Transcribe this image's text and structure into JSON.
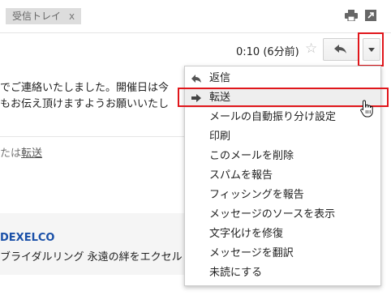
{
  "top_bar": {
    "label_chip": "受信トレイ",
    "label_chip_close": "x"
  },
  "header": {
    "time": "0:10 (6分前)"
  },
  "body": {
    "line1": "でご連絡いたしました。開催日は今",
    "line2": "もお伝え頂けますようお願いいたし",
    "reply_hint_prefix": "たは",
    "reply_hint_link": "転送"
  },
  "promo": {
    "brand": "DEXELCO",
    "text": "ブライダルリング 永遠の絆をエクセル"
  },
  "menu": {
    "items": [
      {
        "label": "返信",
        "icon": "reply-arrow-icon"
      },
      {
        "label": "転送",
        "icon": "forward-arrow-icon"
      },
      {
        "label": "メールの自動振り分け設定"
      },
      {
        "label": "印刷"
      },
      {
        "label": "このメールを削除"
      },
      {
        "label": "スパムを報告"
      },
      {
        "label": "フィッシングを報告"
      },
      {
        "label": "メッセージのソースを表示"
      },
      {
        "label": "文字化けを修復"
      },
      {
        "label": "メッセージを翻訳"
      },
      {
        "label": "未読にする"
      }
    ]
  },
  "colors": {
    "highlight_red": "#e0161b",
    "link_blue": "#1a50a8"
  }
}
